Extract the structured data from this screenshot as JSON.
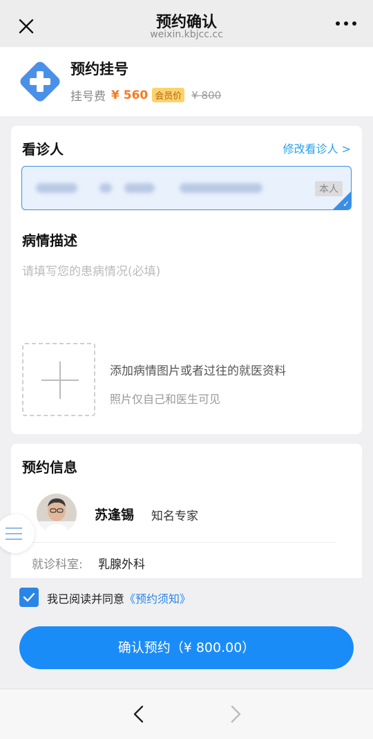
{
  "nav": {
    "title": "预约确认",
    "subtitle": "weixin.kbjcc.cc"
  },
  "service": {
    "name": "预约挂号",
    "fee_label": "挂号费",
    "member_price": "¥ 560",
    "member_badge": "会员价",
    "original_price": "¥ 800"
  },
  "patient": {
    "section_title": "看诊人",
    "edit_link": "修改看诊人 >",
    "self_tag": "本人"
  },
  "condition": {
    "section_title": "病情描述",
    "placeholder": "请填写您的患病情况(必填)",
    "upload_hint": "添加病情图片或者过往的就医资料",
    "upload_note": "照片仅自己和医生可见"
  },
  "appointment": {
    "section_title": "预约信息",
    "doctor_name": "苏逢锡",
    "doctor_title": "知名专家",
    "dept_label": "就诊科室:",
    "dept_value": "乳腺外科"
  },
  "agreement": {
    "text": "我已阅读并同意",
    "link": "《预约须知》"
  },
  "confirm_button": "确认预约（¥ 800.00）",
  "colors": {
    "accent": "#1a8cf8",
    "price": "#f37b1d",
    "badge": "#fbd36a",
    "link": "#2aa0e8"
  },
  "icons": [
    "close-icon",
    "more-icon",
    "medical-cross-icon",
    "check-icon",
    "plus-icon",
    "menu-icon",
    "back-arrow-icon",
    "forward-arrow-icon"
  ]
}
